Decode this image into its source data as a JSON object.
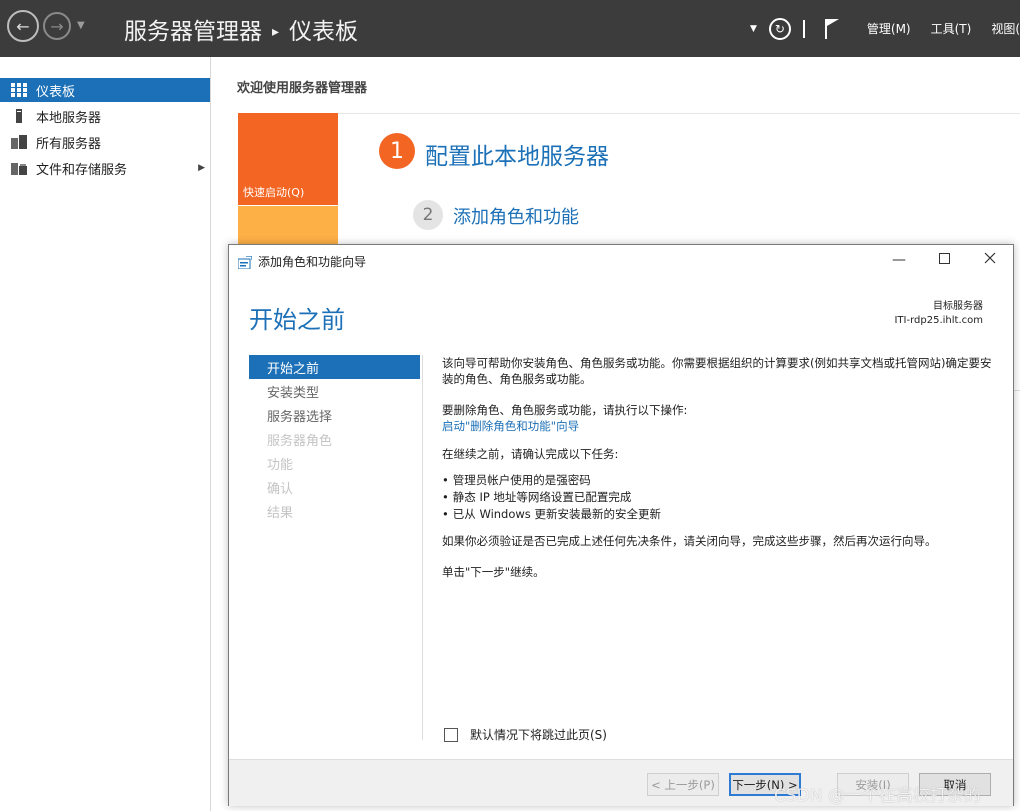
{
  "header": {
    "app_name": "服务器管理器",
    "page_name": "仪表板",
    "crumb_separator": "▸",
    "menus": [
      "管理(M)",
      "工具(T)",
      "视图("
    ]
  },
  "sidebar": {
    "items": [
      {
        "label": "仪表板",
        "icon": "dashboard-icon",
        "active": true
      },
      {
        "label": "本地服务器",
        "icon": "server-icon",
        "active": false
      },
      {
        "label": "所有服务器",
        "icon": "servers-icon",
        "active": false
      },
      {
        "label": "文件和存储服务",
        "icon": "storage-icon",
        "active": false,
        "expandable": true
      }
    ]
  },
  "dashboard": {
    "welcome": "欢迎使用服务器管理器",
    "quick_start": "快速启动(Q)",
    "step1_number": "1",
    "step1_text": "配置此本地服务器",
    "step2_number": "2",
    "step2_text": "添加角色和功能"
  },
  "wizard": {
    "title": "添加角色和功能向导",
    "heading": "开始之前",
    "destination_label": "目标服务器",
    "destination_server": "ITI-rdp25.ihlt.com",
    "nav": [
      {
        "label": "开始之前",
        "state": "active"
      },
      {
        "label": "安装类型",
        "state": "enabled"
      },
      {
        "label": "服务器选择",
        "state": "enabled"
      },
      {
        "label": "服务器角色",
        "state": "disabled"
      },
      {
        "label": "功能",
        "state": "disabled"
      },
      {
        "label": "确认",
        "state": "disabled"
      },
      {
        "label": "结果",
        "state": "disabled"
      }
    ],
    "intro": "该向导可帮助你安装角色、角色服务或功能。你需要根据组织的计算要求(例如共享文档或托管网站)确定要安装的角色、角色服务或功能。",
    "remove_intro": "要删除角色、角色服务或功能，请执行以下操作:",
    "remove_link": "启动\"删除角色和功能\"向导",
    "prereq_intro": "在继续之前，请确认完成以下任务:",
    "prereqs": [
      "管理员帐户使用的是强密码",
      "静态 IP 地址等网络设置已配置完成",
      "已从 Windows 更新安装最新的安全更新"
    ],
    "verify_text": "如果你必须验证是否已完成上述任何先决条件，请关闭向导，完成这些步骤，然后再次运行向导。",
    "continue_text": "单击\"下一步\"继续。",
    "skip_label": "默认情况下将跳过此页(S)",
    "buttons": {
      "prev": "< 上一步(P)",
      "next": "下一步(N) >",
      "install": "安装(I)",
      "cancel": "取消"
    }
  },
  "watermark": "CSDN @一个在高校打杂的",
  "colors": {
    "accent_blue": "#1c70b7",
    "title_bar": "#3c3c3c",
    "quick_start_orange": "#f26522",
    "tile_yellow": "#fdb045"
  }
}
